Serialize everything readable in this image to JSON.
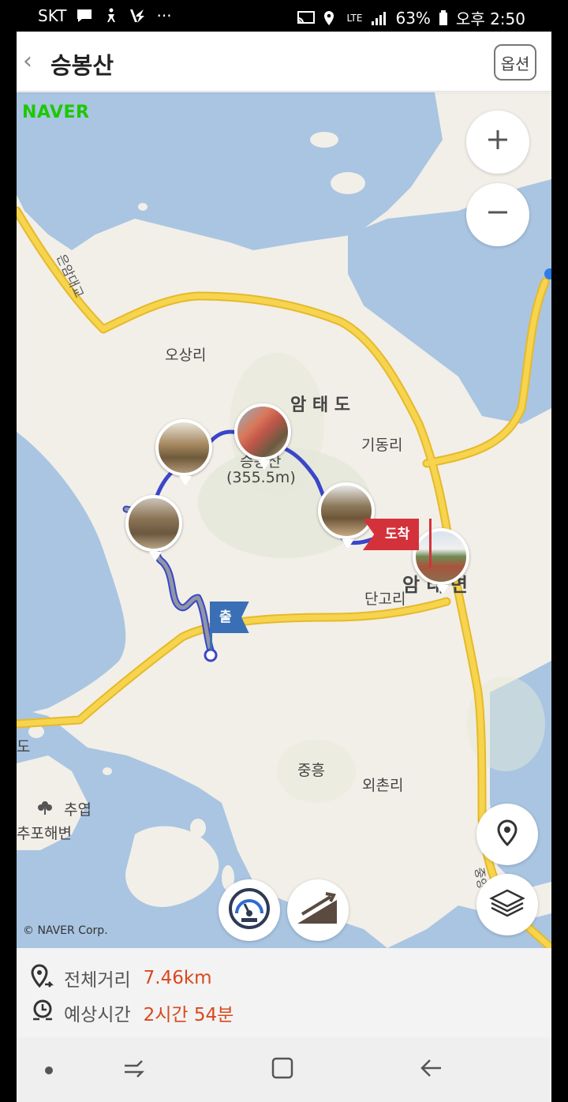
{
  "status_bar": {
    "carrier": "SKT",
    "network": "LTE",
    "battery": "63%",
    "time": "오후 2:50",
    "dots": "···"
  },
  "header": {
    "back_icon": "chevron-left",
    "title": "승봉산",
    "options_label": "옵션"
  },
  "map": {
    "provider_logo": "NAVER",
    "copyright": "© NAVER Corp.",
    "labels": {
      "bridge": "은암대교",
      "osangri": "오상리",
      "amtaedo": "암 태 도",
      "gidongri": "기동리",
      "peak_name": "승봉산",
      "peak_height": "(355.5m)",
      "amtaemyeon": "암 태 면",
      "dangori": "단고리",
      "jungheung": "중흥",
      "oechonri": "외촌리",
      "do": "도",
      "chuyeop": "추엽",
      "chupo_beach": "추포해변",
      "road_right": "중앙"
    },
    "start_flag": "출발지",
    "end_flag": "도착",
    "zoom_in_icon": "plus",
    "zoom_out_icon": "minus",
    "bottom_buttons": [
      "speedometer-icon",
      "slope-icon"
    ],
    "right_buttons": [
      "location-pin-icon",
      "layers-icon"
    ],
    "colors": {
      "water": "#a9c5e2",
      "land": "#f2efe8",
      "road": "#f3c934",
      "route_outer": "#3a46c8",
      "route_inner": "#8f96a6",
      "start_flag": "#3a6fb5",
      "end_flag": "#d4323b"
    }
  },
  "info": {
    "distance_label": "전체거리",
    "distance_value": "7.46km",
    "time_label": "예상시간",
    "time_value": "2시간 54분"
  },
  "nav_bar": [
    "dot",
    "recent-apps",
    "home",
    "back"
  ]
}
